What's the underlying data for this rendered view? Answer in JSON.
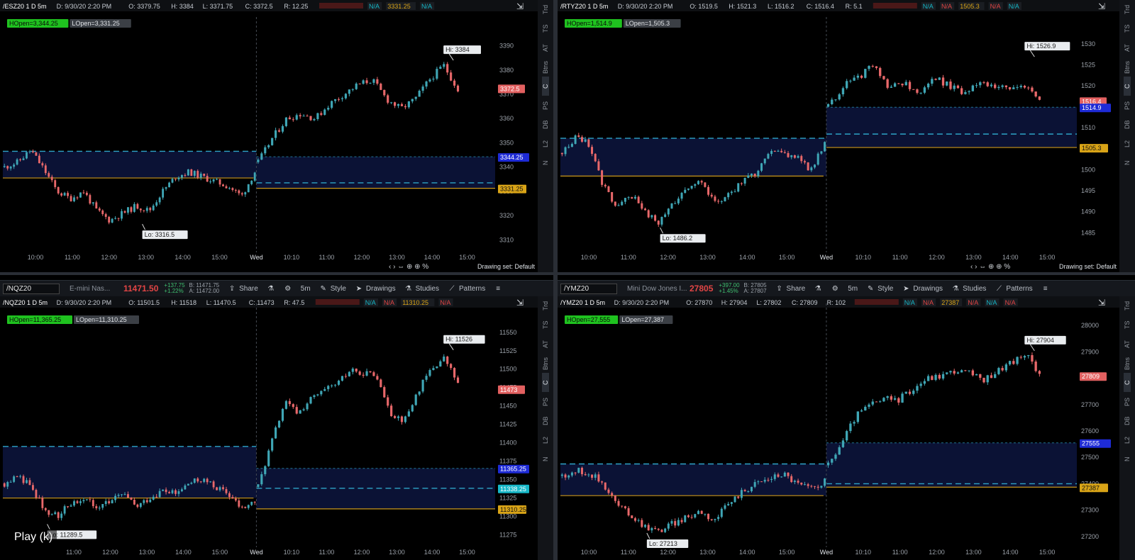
{
  "colors": {
    "up": "#3fa6b5",
    "down": "#e8686a",
    "hopen": "#2ea4c7",
    "lopen": "#c9961a",
    "band": "#0b1235",
    "price_red": "#e24545",
    "hopen_label": "#1e2bd6",
    "lopen_label": "#d9a417",
    "cyan": "#16b7c7"
  },
  "sidebar_items": [
    "Trd",
    "TS",
    "AT",
    "Btns",
    "C",
    "PS",
    "DB",
    "L2",
    "N"
  ],
  "sidebar_active": "C",
  "overlay": {
    "play_label": "Play (k)"
  },
  "panes": [
    {
      "id": "es",
      "header": {
        "symbol": "/ESZ20 1 D 5m",
        "date": "D: 9/30/20 2:20 PM",
        "open": "O: 3379.75",
        "high": "H: 3384",
        "low": "L: 3371.75",
        "close": "C: 3372.5",
        "range": "R: 12.25",
        "values": [
          "N/A",
          "3331.25",
          "N/A"
        ]
      },
      "badges": {
        "hopen": "HOpen=3,344.25",
        "lopen": "LOpen=3,331.25"
      },
      "hi_label": "Hi: 3384",
      "lo_label": "Lo: 3316.5",
      "price_labels": {
        "last": "3372.5",
        "hopen": "3344.25",
        "lopen": "3331.25"
      },
      "y_ticks": [
        "3390",
        "3380",
        "3370",
        "3360",
        "3350",
        "3340",
        "3330",
        "3320",
        "3310"
      ],
      "x_ticks": [
        "10:00",
        "11:00",
        "12:00",
        "13:00",
        "14:00",
        "15:00",
        "Wed",
        "10:10",
        "11:00",
        "12:00",
        "13:00",
        "14:00",
        "15:00"
      ],
      "footer": {
        "drawing_set": "Drawing set: Default"
      },
      "chart_data": {
        "type": "line",
        "ylim": [
          3306,
          3396
        ],
        "hi": 3384,
        "lo": 3316.5,
        "hopen_prev": 3346.5,
        "lopen_prev": 3335.5,
        "hopen": 3344.25,
        "lopen": 3331.25,
        "dashed2": 3333.5,
        "last": 3372.5,
        "prev_y": [
          3340,
          3342,
          3347,
          3339,
          3330,
          3327,
          3330,
          3322,
          3318,
          3321,
          3324,
          3322,
          3330,
          3336,
          3338,
          3336,
          3334,
          3332,
          3328,
          3338
        ],
        "today_y": [
          3342,
          3352,
          3360,
          3362,
          3360,
          3366,
          3370,
          3374,
          3376,
          3368,
          3364,
          3368,
          3376,
          3382,
          3372
        ]
      }
    },
    {
      "id": "rty",
      "header": {
        "symbol": "/RTYZ20 1 D 5m",
        "date": "D: 9/30/20 2:20 PM",
        "open": "O: 1519.5",
        "high": "H: 1521.3",
        "low": "L: 1516.2",
        "close": "C: 1516.4",
        "range": "R: 5.1",
        "values": [
          "N/A",
          "N/A",
          "1505.3",
          "N/A",
          "N/A"
        ]
      },
      "badges": {
        "hopen": "HOpen=1,514.9",
        "lopen": "LOpen=1,505.3"
      },
      "hi_label": "Hi: 1526.9",
      "lo_label": "Lo: 1486.2",
      "price_labels": {
        "last": "1516.4",
        "hopen": "1514.9",
        "lopen": "1505.3"
      },
      "y_ticks": [
        "1530",
        "1525",
        "1520",
        "1515",
        "1510",
        "1505",
        "1500",
        "1495",
        "1490",
        "1485"
      ],
      "x_ticks": [
        "10:00",
        "11:00",
        "12:00",
        "13:00",
        "14:00",
        "15:00",
        "Wed",
        "10:10",
        "11:00",
        "12:00",
        "13:00",
        "14:00",
        "15:00"
      ],
      "footer": {
        "drawing_set": "Drawing set: Default"
      },
      "chart_data": {
        "type": "line",
        "ylim": [
          1481,
          1533
        ],
        "hi": 1526.9,
        "lo": 1486.2,
        "hopen_prev": 1507.5,
        "lopen_prev": 1498.5,
        "hopen": 1514.9,
        "lopen": 1505.3,
        "dashed2": 1508.5,
        "last": 1516.4,
        "prev_y": [
          1504,
          1508,
          1506,
          1496,
          1491,
          1494,
          1490,
          1487,
          1492,
          1496,
          1497,
          1492,
          1494,
          1497,
          1499,
          1505,
          1504,
          1503,
          1500,
          1506
        ],
        "today_y": [
          1515,
          1520,
          1522,
          1525,
          1519,
          1521,
          1518,
          1522,
          1520,
          1518,
          1521,
          1520,
          1519,
          1520,
          1516
        ]
      }
    },
    {
      "id": "nq",
      "toolbar": {
        "symbol": "/NQZ20",
        "desc": "E-mini Nas...",
        "price": "11471.50",
        "chg1": "+137.75",
        "chg2": "+1.22%",
        "bid": "B: 11471.75",
        "ask": "A: 11472.00",
        "share": "Share",
        "time": "5m",
        "style": "Style",
        "drawings": "Drawings",
        "studies": "Studies",
        "patterns": "Patterns"
      },
      "header": {
        "symbol": "/NQZ20 1 D 5m",
        "date": "D: 9/30/20 2:20 PM",
        "open": "O: 11501.5",
        "high": "H: 11518",
        "low": "L: 11470.5",
        "close": "C: 11473",
        "range": "R: 47.5",
        "values": [
          "N/A",
          "N/A",
          "11310.25",
          "N/A"
        ]
      },
      "badges": {
        "hopen": "HOpen=11,365.25",
        "lopen": "LOpen=11,310.25"
      },
      "hi_label": "Hi: 11526",
      "lo_label": "Lo: 11289.5",
      "price_labels": {
        "last": "11473",
        "hopen": "11365.25",
        "cyan": "11338.25",
        "lopen": "11310.25"
      },
      "y_ticks": [
        "11550",
        "11525",
        "11500",
        "11475",
        "11450",
        "11425",
        "11400",
        "11375",
        "11350",
        "11325",
        "11300",
        "11275"
      ],
      "x_ticks": [
        "11:00",
        "12:00",
        "13:00",
        "14:00",
        "15:00",
        "Wed",
        "10:10",
        "11:00",
        "12:00",
        "13:00",
        "14:00",
        "15:00"
      ],
      "chart_data": {
        "type": "line",
        "ylim": [
          11262,
          11570
        ],
        "hi": 11526,
        "lo": 11289.5,
        "hopen_prev": 11395,
        "lopen_prev": 11325,
        "hopen": 11365.25,
        "lopen": 11310.25,
        "dashed2": 11338.25,
        "last": 11473,
        "prev_y": [
          11345,
          11355,
          11340,
          11310,
          11300,
          11318,
          11325,
          11315,
          11320,
          11330,
          11312,
          11325,
          11335,
          11330,
          11345,
          11350,
          11340,
          11330,
          11310,
          11320
        ],
        "today_y": [
          11340,
          11400,
          11455,
          11440,
          11460,
          11470,
          11480,
          11500,
          11495,
          11490,
          11440,
          11430,
          11470,
          11500,
          11515,
          11480
        ]
      }
    },
    {
      "id": "ym",
      "toolbar": {
        "symbol": "/YMZ20",
        "desc": "Mini Dow Jones I...",
        "price": "27805",
        "chg1": "+397.00",
        "chg2": "+1.45%",
        "bid": "B: 27805",
        "ask": "A: 27807",
        "share": "Share",
        "time": "5m",
        "style": "Style",
        "drawings": "Drawings",
        "studies": "Studies",
        "patterns": "Patterns"
      },
      "header": {
        "symbol": "/YMZ20 1 D 5m",
        "date": "D: 9/30/20 2:20 PM",
        "open": "O: 27870",
        "high": "H: 27904",
        "low": "L: 27802",
        "close": "C: 27809",
        "range": "R: 102",
        "values": [
          "N/A",
          "N/A",
          "27387",
          "N/A",
          "N/A",
          "N/A"
        ]
      },
      "badges": {
        "hopen": "HOpen=27,555",
        "lopen": "LOpen=27,387"
      },
      "hi_label": "Hi: 27904",
      "lo_label": "Lo: 27213",
      "price_labels": {
        "last": "27809",
        "hopen": "27555",
        "lopen": "27387"
      },
      "y_ticks": [
        "28000",
        "27900",
        "27800",
        "27700",
        "27600",
        "27500",
        "27400",
        "27300",
        "27200"
      ],
      "x_ticks": [
        "10:00",
        "11:00",
        "12:00",
        "13:00",
        "14:00",
        "15:00",
        "Wed",
        "10:10",
        "11:00",
        "12:00",
        "13:00",
        "14:00",
        "15:00"
      ],
      "chart_data": {
        "type": "line",
        "ylim": [
          27170,
          28030
        ],
        "hi": 27904,
        "lo": 27213,
        "hopen_prev": 27475,
        "lopen_prev": 27355,
        "hopen": 27555,
        "lopen": 27387,
        "dashed2": 27400,
        "last": 27809,
        "prev_y": [
          27430,
          27450,
          27440,
          27400,
          27320,
          27280,
          27240,
          27220,
          27250,
          27270,
          27300,
          27260,
          27320,
          27370,
          27400,
          27420,
          27440,
          27400,
          27380,
          27410
        ],
        "today_y": [
          27470,
          27560,
          27660,
          27700,
          27720,
          27720,
          27760,
          27800,
          27810,
          27830,
          27820,
          27790,
          27830,
          27860,
          27890,
          27820
        ]
      }
    }
  ]
}
